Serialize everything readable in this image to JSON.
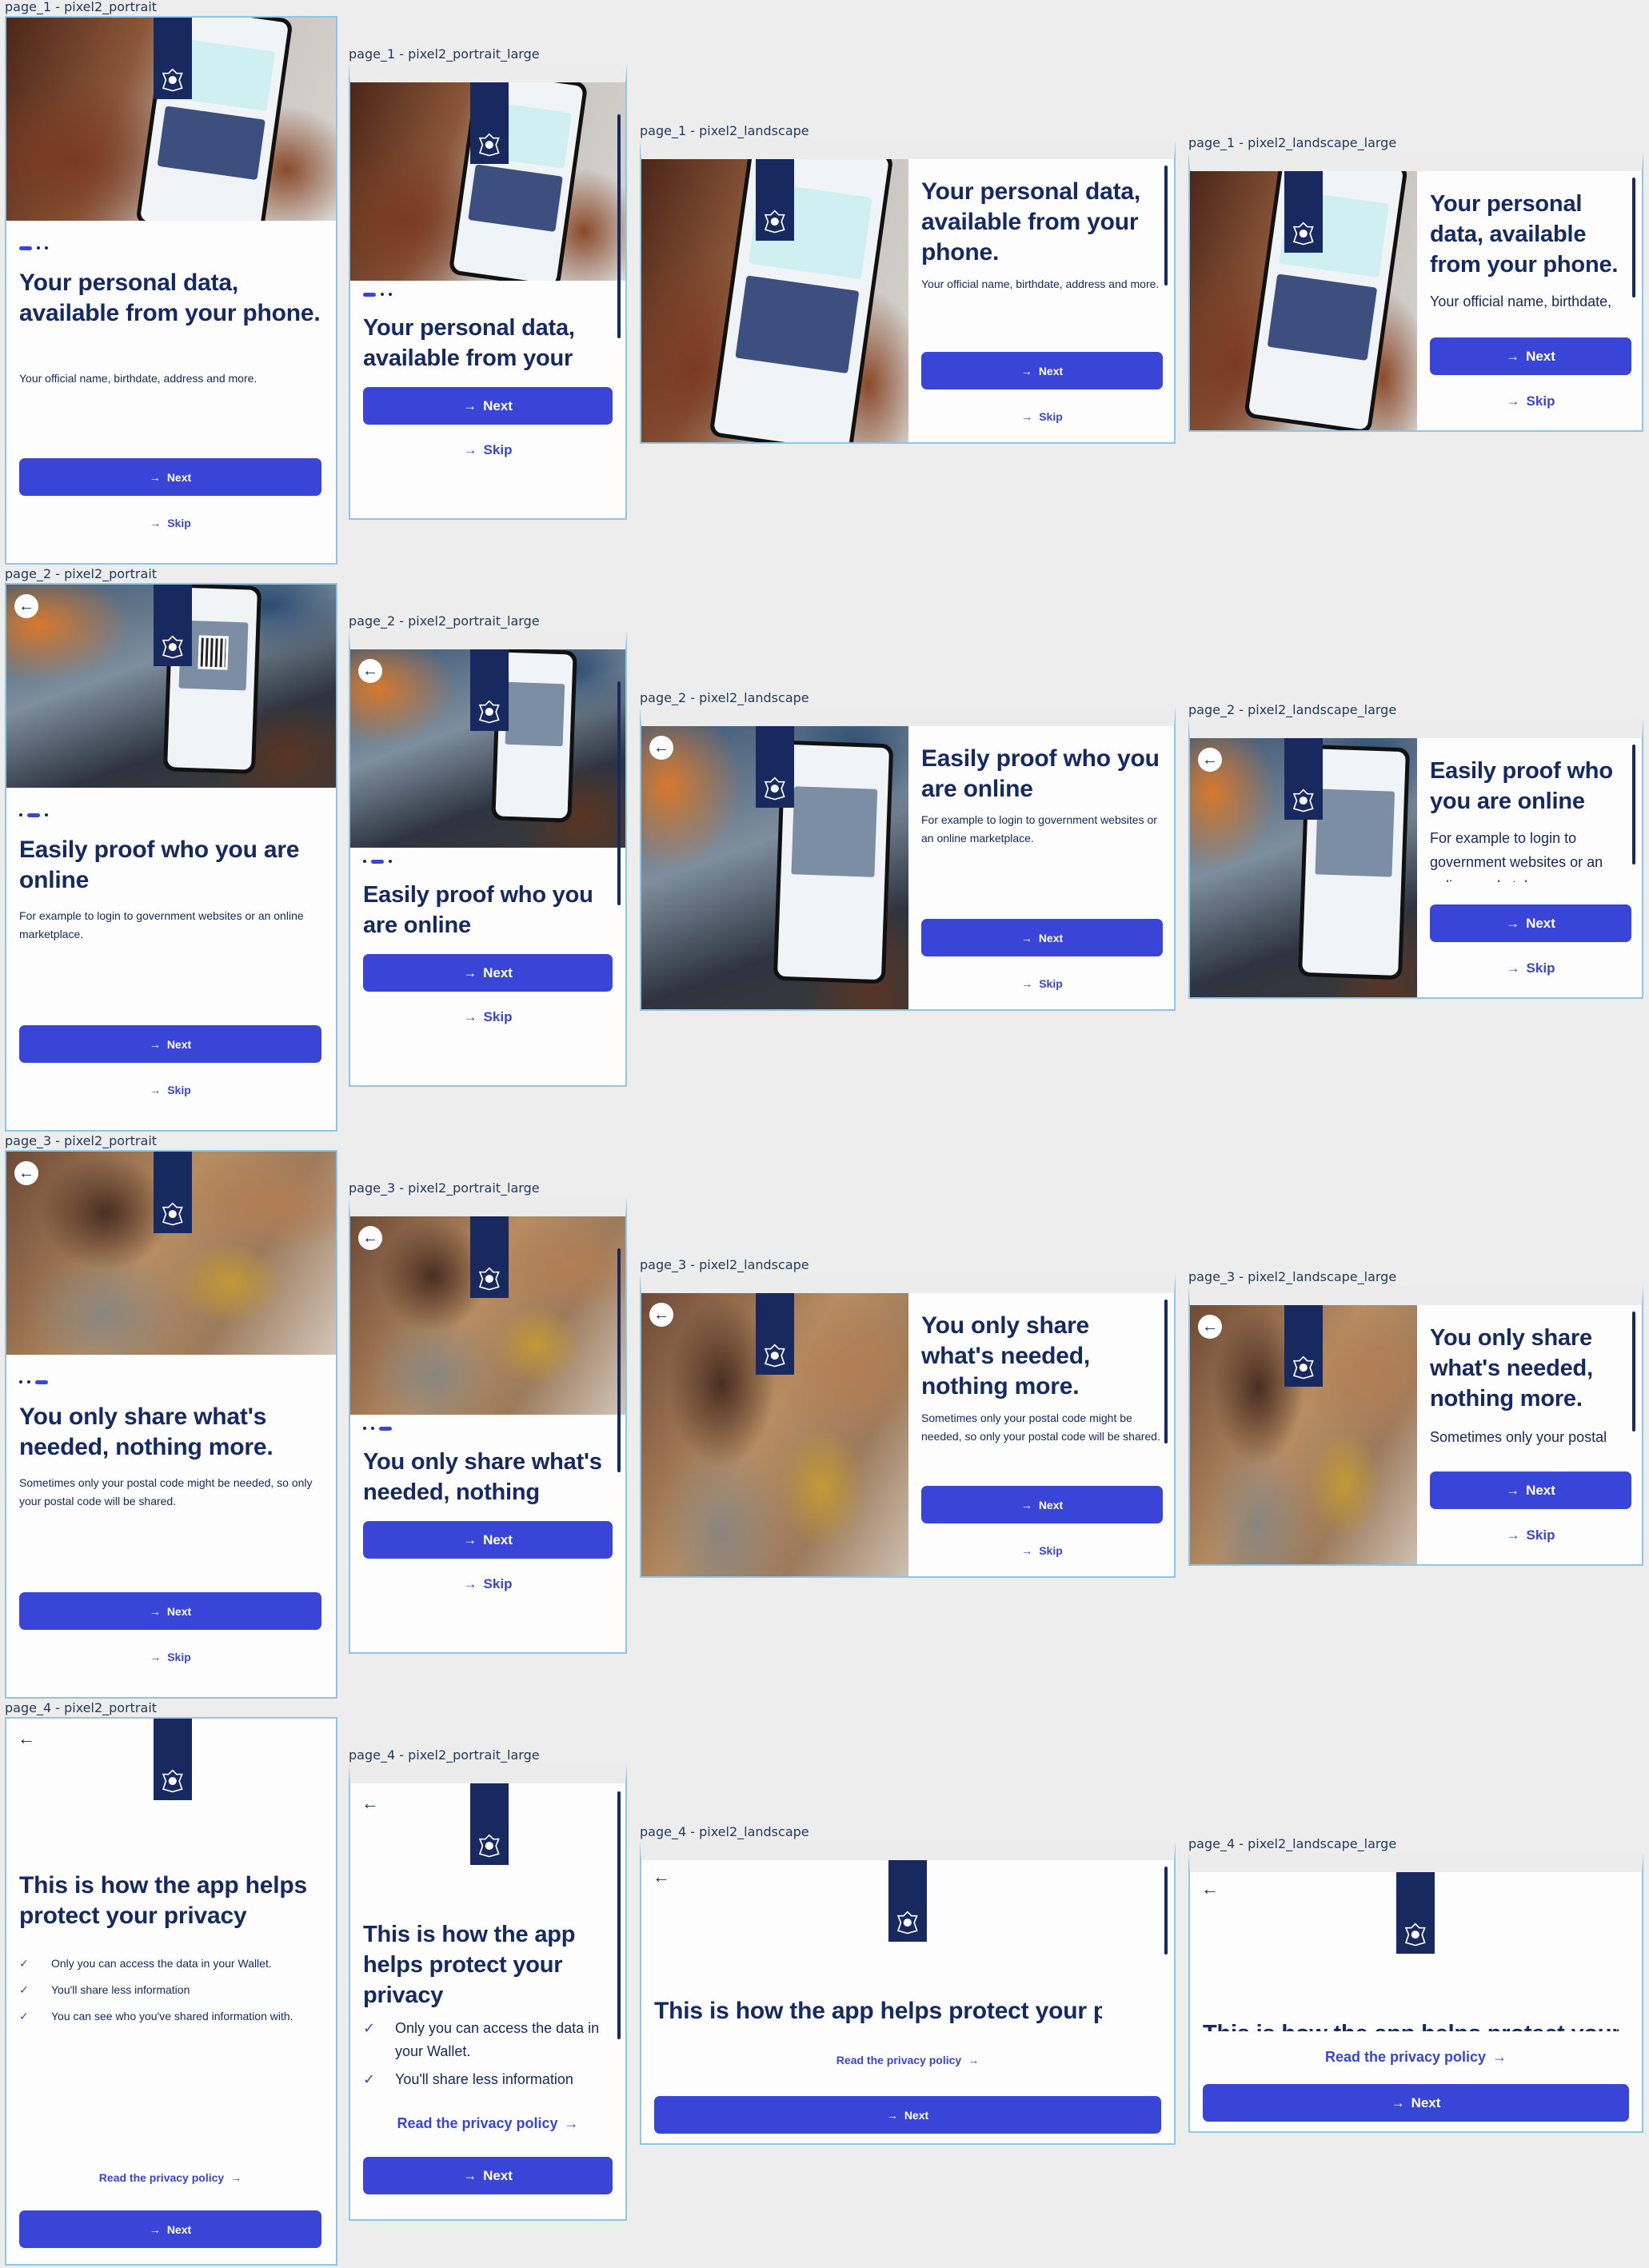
{
  "labels": {
    "f1a": "page_1 - pixel2_portrait",
    "f1b": "page_1 - pixel2_portrait_large",
    "f1c": "page_1 - pixel2_landscape",
    "f1d": "page_1 - pixel2_landscape_large",
    "f2a": "page_2 - pixel2_portrait",
    "f2b": "page_2 - pixel2_portrait_large",
    "f2c": "page_2 - pixel2_landscape",
    "f2d": "page_2 - pixel2_landscape_large",
    "f3a": "page_3 - pixel2_portrait",
    "f3b": "page_3 - pixel2_portrait_large",
    "f3c": "page_3 - pixel2_landscape",
    "f3d": "page_3 - pixel2_landscape_large",
    "f4a": "page_4 - pixel2_portrait",
    "f4b": "page_4 - pixel2_portrait_large",
    "f4c": "page_4 - pixel2_landscape",
    "f4d": "page_4 - pixel2_landscape_large"
  },
  "page1": {
    "title": "Your personal data, available from your phone.",
    "description": "Your official name, birthdate, address and more."
  },
  "page2": {
    "title": "Easily proof who you are online",
    "description": "For example to login to government websites or an online marketplace."
  },
  "page3": {
    "title": "You only share what's needed, nothing more.",
    "description": "Sometimes only your postal code might be needed, so only your postal code will be shared."
  },
  "page4": {
    "title": "This is how the app helps protect your privacy",
    "bullets": [
      "Only you can access the data in your Wallet.",
      "You'll share less information",
      "You can see who you've shared information with."
    ],
    "privacy_link": "Read the privacy policy"
  },
  "buttons": {
    "next": "Next",
    "skip": "Skip"
  },
  "icons": {
    "arrow": "→",
    "back": "←",
    "check": "✓"
  },
  "colors": {
    "primary": "#3845d6",
    "text": "#152a62",
    "logo_bg": "#17295f",
    "frame_border": "#8ec7e6"
  }
}
